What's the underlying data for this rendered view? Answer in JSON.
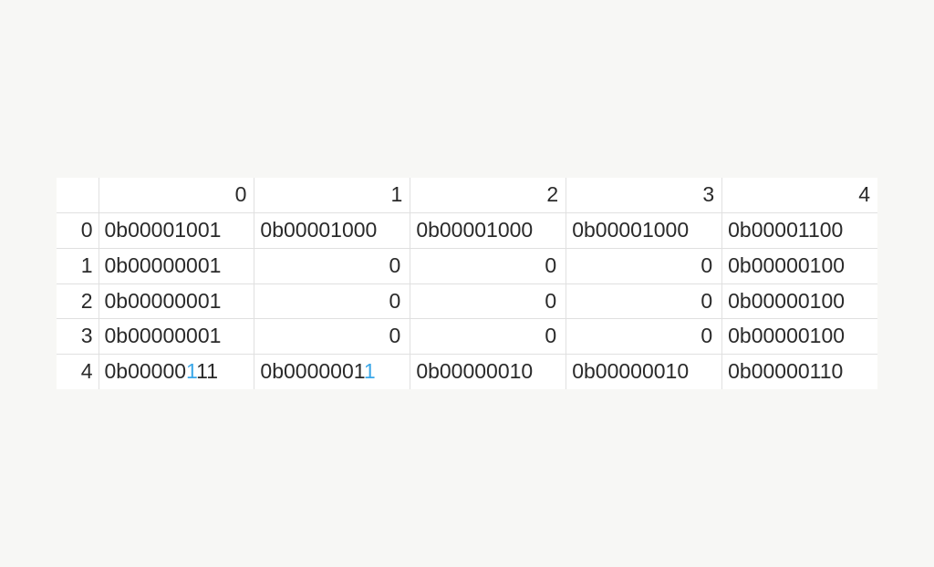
{
  "table": {
    "columns": [
      "0",
      "1",
      "2",
      "3",
      "4"
    ],
    "rows": [
      {
        "index": "0",
        "cells": [
          {
            "parts": [
              "0b00001001"
            ],
            "align": "left"
          },
          {
            "parts": [
              "0b00001000"
            ],
            "align": "left"
          },
          {
            "parts": [
              "0b00001000"
            ],
            "align": "left"
          },
          {
            "parts": [
              "0b00001000"
            ],
            "align": "left"
          },
          {
            "parts": [
              "0b00001100"
            ],
            "align": "left"
          }
        ]
      },
      {
        "index": "1",
        "cells": [
          {
            "parts": [
              "0b00000001"
            ],
            "align": "left"
          },
          {
            "parts": [
              "0"
            ],
            "align": "right"
          },
          {
            "parts": [
              "0"
            ],
            "align": "right"
          },
          {
            "parts": [
              "0"
            ],
            "align": "right"
          },
          {
            "parts": [
              "0b00000100"
            ],
            "align": "left"
          }
        ]
      },
      {
        "index": "2",
        "cells": [
          {
            "parts": [
              "0b00000001"
            ],
            "align": "left"
          },
          {
            "parts": [
              "0"
            ],
            "align": "right"
          },
          {
            "parts": [
              "0"
            ],
            "align": "right"
          },
          {
            "parts": [
              "0"
            ],
            "align": "right"
          },
          {
            "parts": [
              "0b00000100"
            ],
            "align": "left"
          }
        ]
      },
      {
        "index": "3",
        "cells": [
          {
            "parts": [
              "0b00000001"
            ],
            "align": "left"
          },
          {
            "parts": [
              "0"
            ],
            "align": "right"
          },
          {
            "parts": [
              "0"
            ],
            "align": "right"
          },
          {
            "parts": [
              "0"
            ],
            "align": "right"
          },
          {
            "parts": [
              "0b00000100"
            ],
            "align": "left"
          }
        ]
      },
      {
        "index": "4",
        "cells": [
          {
            "parts": [
              "0b00000",
              {
                "hl": "1"
              },
              "11"
            ],
            "align": "left"
          },
          {
            "parts": [
              "0b0000001",
              {
                "hl": "1"
              }
            ],
            "align": "left"
          },
          {
            "parts": [
              "0b00000010"
            ],
            "align": "left"
          },
          {
            "parts": [
              "0b00000010"
            ],
            "align": "left"
          },
          {
            "parts": [
              "0b00000110"
            ],
            "align": "left"
          }
        ]
      }
    ]
  }
}
